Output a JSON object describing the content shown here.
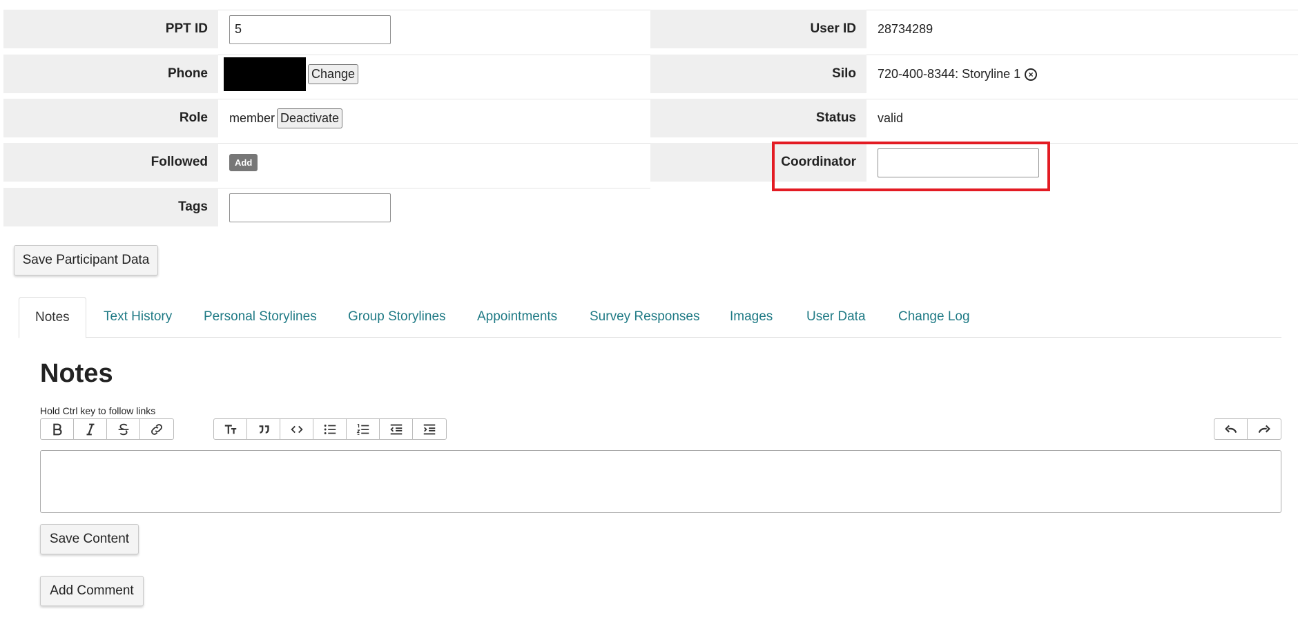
{
  "participant": {
    "ppt_id_label": "PPT ID",
    "ppt_id_value": "5",
    "phone_label": "Phone",
    "phone_change_button": "Change",
    "role_label": "Role",
    "role_value": "member",
    "role_deactivate_button": "Deactivate",
    "followed_label": "Followed",
    "followed_add_button": "Add",
    "tags_label": "Tags",
    "tags_value": "",
    "user_id_label": "User ID",
    "user_id_value": "28734289",
    "silo_label": "Silo",
    "silo_value": "720-400-8344: Storyline 1",
    "status_label": "Status",
    "status_value": "valid",
    "coordinator_label": "Coordinator",
    "coordinator_value": ""
  },
  "save_participant_button": "Save Participant Data",
  "tabs": [
    {
      "label": "Notes",
      "active": true
    },
    {
      "label": "Text History"
    },
    {
      "label": "Personal Storylines"
    },
    {
      "label": "Group Storylines"
    },
    {
      "label": "Appointments"
    },
    {
      "label": "Survey Responses"
    },
    {
      "label": "Images"
    },
    {
      "label": "User Data"
    },
    {
      "label": "Change Log"
    }
  ],
  "notes": {
    "title": "Notes",
    "hint": "Hold Ctrl key to follow links",
    "content": "",
    "save_button": "Save Content",
    "add_comment_button": "Add Comment"
  },
  "toolbar_icons": {
    "format": [
      "bold-icon",
      "italic-icon",
      "strikethrough-icon",
      "link-icon"
    ],
    "blocks": [
      "heading-icon",
      "quote-icon",
      "code-icon",
      "bullet-list-icon",
      "numbered-list-icon",
      "outdent-icon",
      "indent-icon"
    ],
    "history": [
      "undo-icon",
      "redo-icon"
    ]
  },
  "colors": {
    "tab_link": "#1f7a85",
    "label_bg": "#efefef",
    "highlight_border": "#e31b23",
    "add_badge_bg": "#777777"
  }
}
